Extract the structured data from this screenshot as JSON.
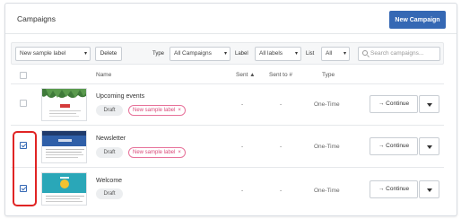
{
  "header": {
    "title": "Campaigns",
    "new_campaign_label": "New Campaign"
  },
  "toolbar": {
    "label_select": "New sample label",
    "delete_label": "Delete",
    "type_label": "Type",
    "type_value": "All Campaigns",
    "label_label": "Label",
    "label_value": "All labels",
    "list_label": "List",
    "list_value": "All",
    "search_placeholder": "Search campaigns..."
  },
  "columns": {
    "name": "Name",
    "sent": "Sent ▲",
    "sent_to": "Sent to #",
    "type": "Type"
  },
  "rows": [
    {
      "name": "Upcoming events",
      "status": "Draft",
      "label": "New sample label",
      "sent": "-",
      "sent_to": "-",
      "type": "One-Time",
      "action": "Continue",
      "checked": false
    },
    {
      "name": "Newsletter",
      "status": "Draft",
      "label": "New sample label",
      "sent": "-",
      "sent_to": "-",
      "type": "One-Time",
      "action": "Continue",
      "checked": true
    },
    {
      "name": "Welcome",
      "status": "Draft",
      "sent": "-",
      "sent_to": "-",
      "type": "One-Time",
      "action": "Continue",
      "checked": true
    }
  ],
  "icons": {
    "caret": "caret-down-icon",
    "search": "search-icon",
    "arrow": "arrow-right-icon",
    "remove": "x-icon"
  },
  "colors": {
    "primary": "#3568b4",
    "tag": "#d94b7a",
    "highlight": "#e02424"
  }
}
